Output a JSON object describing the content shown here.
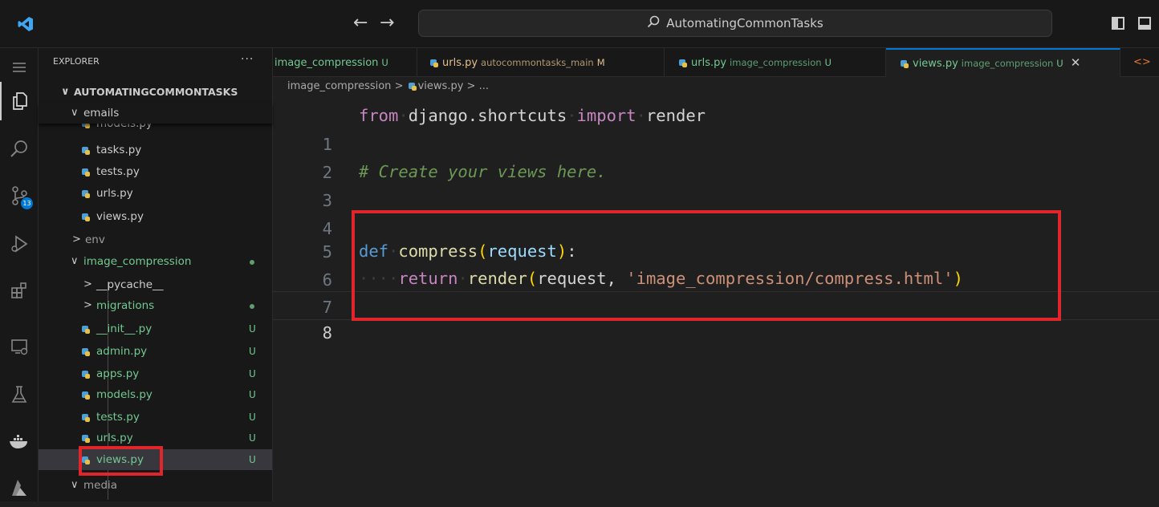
{
  "titlebar": {
    "back_icon": "arrow-left-icon",
    "forward_icon": "arrow-right-icon",
    "search_text": "AutomatingCommonTasks"
  },
  "activity_bar": {
    "items": [
      "menu-icon",
      "explorer-icon",
      "search-icon",
      "source-control-icon",
      "run-debug-icon",
      "extensions-icon",
      "remote-explorer-icon",
      "testing-icon",
      "docker-icon",
      "azure-icon"
    ],
    "source_control_badge": "13"
  },
  "sidebar": {
    "title": "EXPLORER",
    "more": "···",
    "root": "AUTOMATINGCOMMONTASKS",
    "emails_folder": "emails",
    "emails_files": [
      "models.py",
      "tasks.py",
      "tests.py",
      "urls.py",
      "views.py"
    ],
    "env_folder": "env",
    "image_compression_folder": "image_compression",
    "image_compression_children": [
      {
        "name": "__pycache__",
        "kind": "folder"
      },
      {
        "name": "migrations",
        "kind": "folder"
      },
      {
        "name": "__init__.py",
        "status": "U"
      },
      {
        "name": "admin.py",
        "status": "U"
      },
      {
        "name": "apps.py",
        "status": "U"
      },
      {
        "name": "models.py",
        "status": "U"
      },
      {
        "name": "tests.py",
        "status": "U"
      },
      {
        "name": "urls.py",
        "status": "U"
      },
      {
        "name": "views.py",
        "status": "U"
      }
    ],
    "media_folder": "media"
  },
  "tabs": [
    {
      "name": "image_compression",
      "desc": "",
      "status": "U"
    },
    {
      "name": "urls.py",
      "desc": "autocommontasks_main",
      "status": "M"
    },
    {
      "name": "urls.py",
      "desc": "image_compression",
      "status": "U"
    },
    {
      "name": "views.py",
      "desc": "image_compression",
      "status": "U",
      "close": "✕"
    }
  ],
  "breadcrumbs": {
    "folder": "image_compression",
    "sep": ">",
    "file": "views.py",
    "tail": "..."
  },
  "editor": {
    "line_numbers": [
      "1",
      "2",
      "3",
      "4",
      "5",
      "6",
      "7",
      "8"
    ],
    "l1": {
      "kw": "from",
      "mod": "django.shortcuts",
      "kw2": "import",
      "name": "render"
    },
    "l3": "# Create your views here.",
    "l6": {
      "kw": "def",
      "fn": "compress",
      "open": "(",
      "param": "request",
      "close": ")",
      "colon": ":"
    },
    "l7": {
      "indent": "····",
      "kw": "return",
      "fn": "render",
      "open": "(",
      "arg": "request, ",
      "str": "'image_compression/compress.html'",
      "close": ")"
    }
  }
}
